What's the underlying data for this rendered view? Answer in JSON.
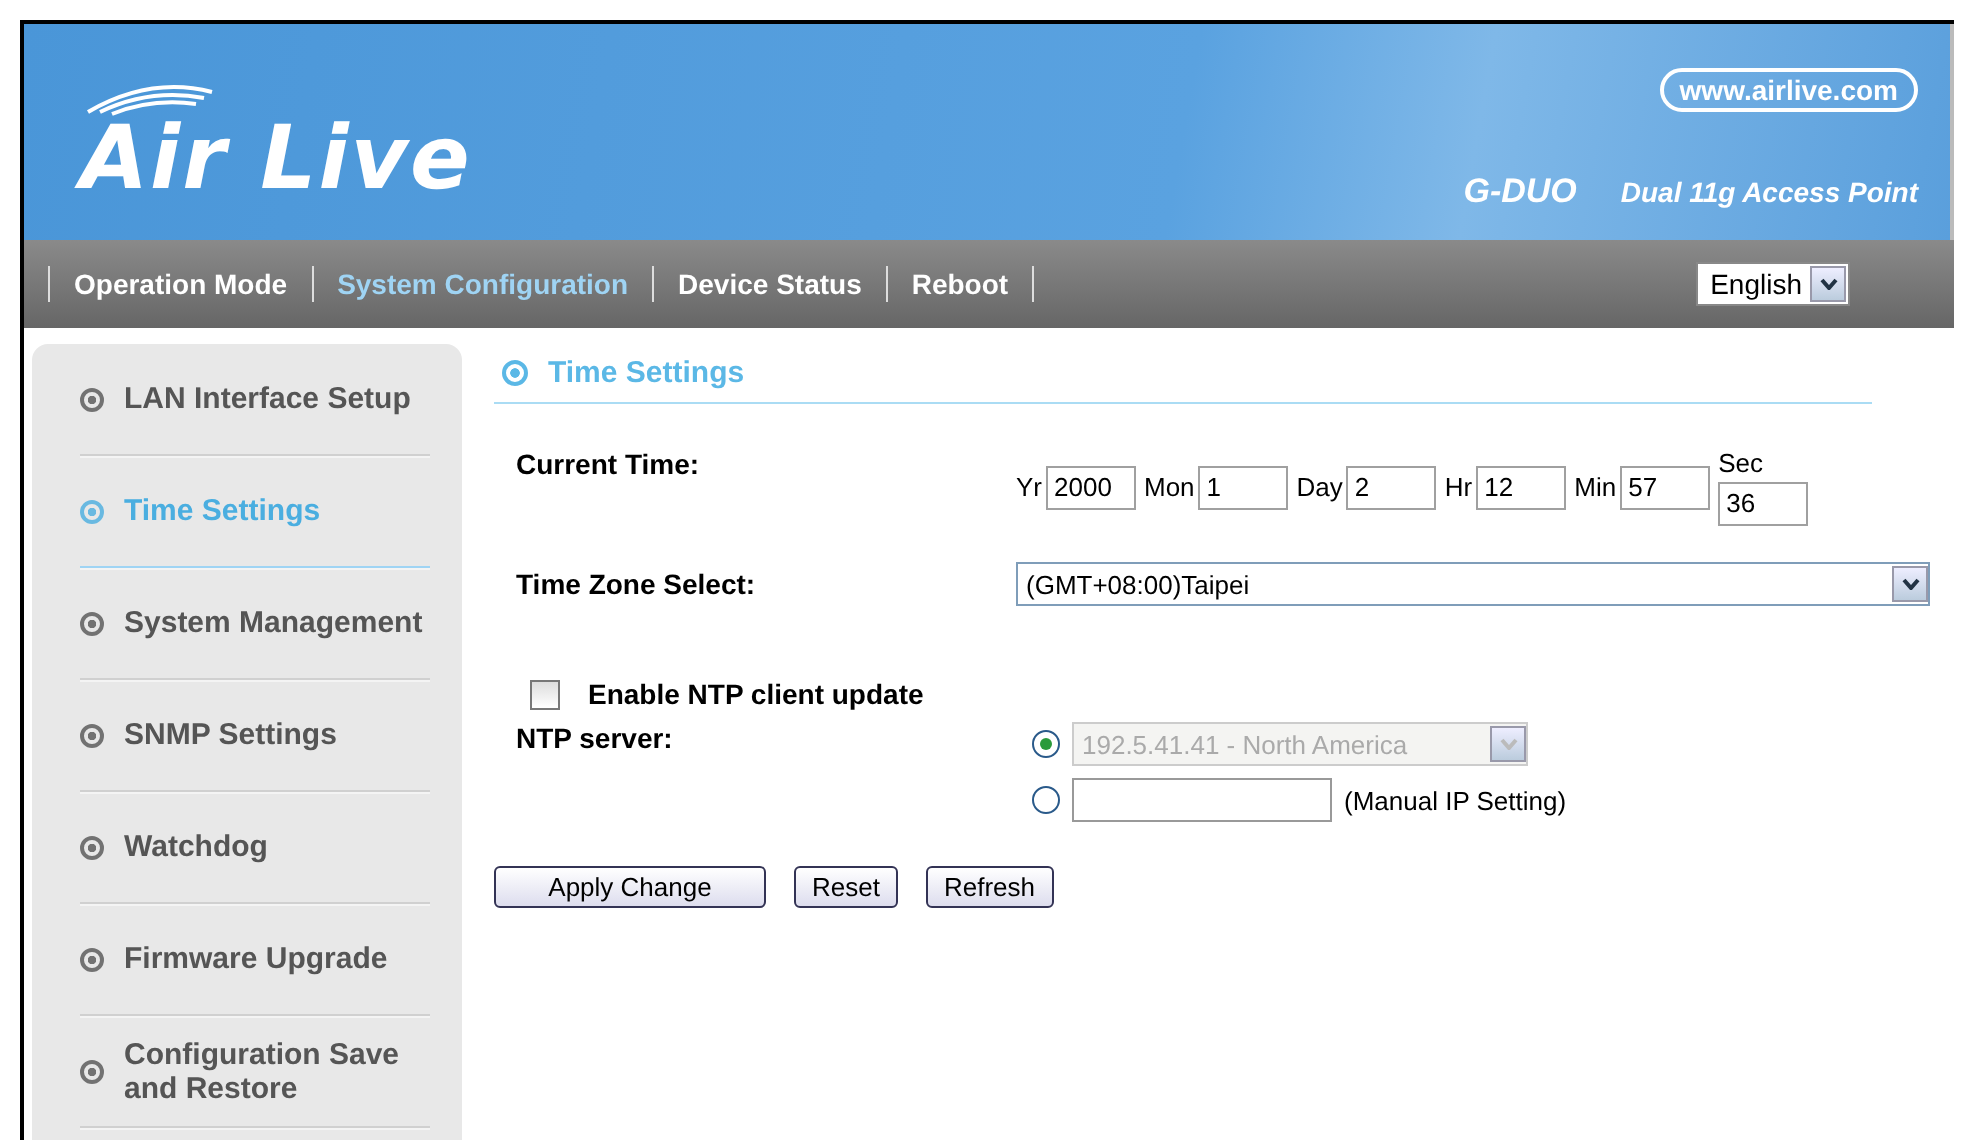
{
  "header": {
    "logo": "Air Live",
    "url": "www.airlive.com",
    "model": "G-DUO",
    "product": "Dual 11g Access Point"
  },
  "nav": {
    "items": [
      {
        "label": "Operation Mode",
        "selected": false
      },
      {
        "label": "System Configuration",
        "selected": true
      },
      {
        "label": "Device Status",
        "selected": false
      },
      {
        "label": "Reboot",
        "selected": false
      }
    ],
    "language": "English"
  },
  "sidebar": {
    "items": [
      {
        "label": "LAN Interface Setup",
        "selected": false
      },
      {
        "label": "Time Settings",
        "selected": true
      },
      {
        "label": "System Management",
        "selected": false
      },
      {
        "label": "SNMP Settings",
        "selected": false
      },
      {
        "label": "Watchdog",
        "selected": false
      },
      {
        "label": "Firmware Upgrade",
        "selected": false
      },
      {
        "label": "Configuration Save and Restore",
        "selected": false
      }
    ]
  },
  "section_title": "Time Settings",
  "current_time": {
    "label": "Current Time:",
    "fields": [
      {
        "label": "Yr",
        "value": "2000"
      },
      {
        "label": "Mon",
        "value": "1"
      },
      {
        "label": "Day",
        "value": "2"
      },
      {
        "label": "Hr",
        "value": "12"
      },
      {
        "label": "Min",
        "value": "57"
      },
      {
        "label": "Sec",
        "value": "36"
      }
    ]
  },
  "time_zone": {
    "label": "Time Zone Select:",
    "value": "(GMT+08:00)Taipei"
  },
  "ntp_enable": {
    "label": "Enable NTP client update",
    "checked": false
  },
  "ntp_server": {
    "label": "NTP server:",
    "options": [
      {
        "kind": "select",
        "value": "192.5.41.41 - North America",
        "selected": true,
        "disabled": true
      },
      {
        "kind": "manual",
        "note": "(Manual IP Setting)",
        "selected": false
      }
    ]
  },
  "buttons": [
    "Apply Change",
    "Reset",
    "Refresh"
  ]
}
